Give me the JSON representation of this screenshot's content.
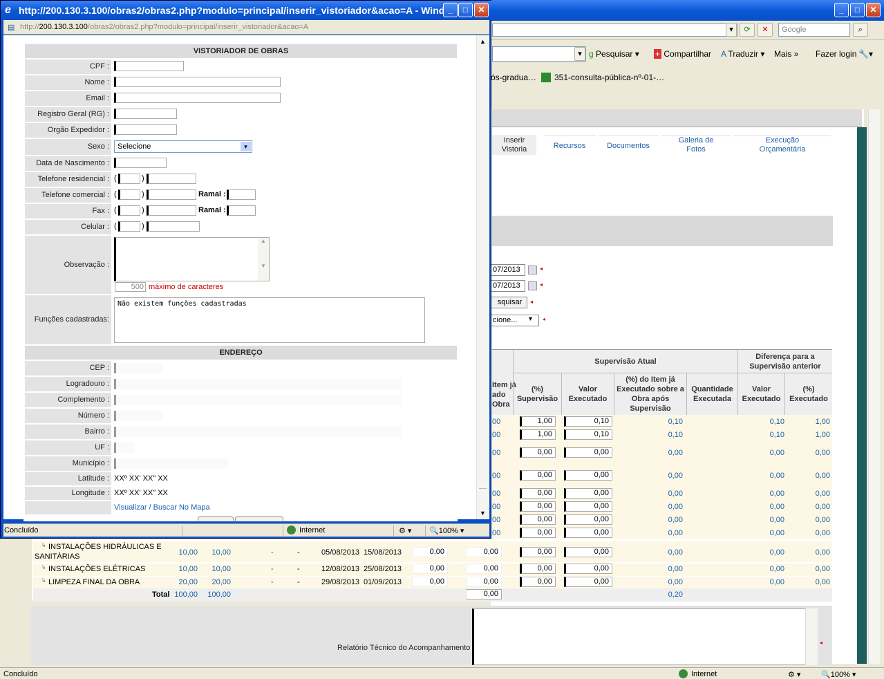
{
  "background_window": {
    "google_placeholder": "Google",
    "toolbar": {
      "pesquisar": "Pesquisar",
      "compartilhar": "Compartilhar",
      "traduzir": "Traduzir",
      "mais": "Mais",
      "login": "Fazer login"
    },
    "favorites": [
      "ós-gradua…",
      "351-consulta-pública-nº-01-…"
    ],
    "tabs": [
      "Inserir Vistoria",
      "Recursos",
      "Documentos",
      "Galeria de Fotos",
      "Execução Orçamentária"
    ],
    "filters": {
      "date1": "07/2013",
      "date2": "07/2013",
      "search_btn": "squisar",
      "select": "cione..."
    },
    "grid": {
      "group_supervisao_atual": "Supervisão Atual",
      "group_diferenca": "Diferença para a Supervisão anterior",
      "col_partial": "Item já\nado\nObra",
      "cols": [
        "(%) Supervisão",
        "Valor Executado",
        "(%) do Item já Executado sobre a Obra após Supervisão",
        "Quantidade Executada",
        "Valor Executado",
        "(%) Executado"
      ],
      "rows": [
        {
          "partial": "00",
          "pct": "1,00",
          "valor": "0,10",
          "item": "0,10",
          "dvalor": "0,10",
          "dpct": "1,00"
        },
        {
          "partial": "00",
          "pct": "1,00",
          "valor": "0,10",
          "item": "0,10",
          "dvalor": "0,10",
          "dpct": "1,00"
        },
        {
          "partial": "00",
          "pct": "0,00",
          "valor": "0,00",
          "item": "0,00",
          "dvalor": "0,00",
          "dpct": "0,00"
        },
        {
          "partial": "00",
          "pct": "0,00",
          "valor": "0,00",
          "item": "0,00",
          "dvalor": "0,00",
          "dpct": "0,00"
        },
        {
          "partial": "00",
          "pct": "0,00",
          "valor": "0,00",
          "item": "0,00",
          "dvalor": "0,00",
          "dpct": "0,00"
        },
        {
          "partial": "00",
          "pct": "0,00",
          "valor": "0,00",
          "item": "0,00",
          "dvalor": "0,00",
          "dpct": "0,00"
        },
        {
          "partial": "00",
          "pct": "0,00",
          "valor": "0,00",
          "item": "0,00",
          "dvalor": "0,00",
          "dpct": "0,00"
        },
        {
          "partial": "00",
          "pct": "0,00",
          "valor": "0,00",
          "item": "0,00",
          "dvalor": "0,00",
          "dpct": "0,00"
        }
      ],
      "full_rows": [
        {
          "name": "INSTALAÇÕES HIDRÁULICAS E SANITÁRIAS",
          "p1": "10,00",
          "p2": "10,00",
          "d1": "-",
          "d2": "-",
          "ini": "05/08/2013",
          "fim": "15/08/2013",
          "v1": "0,00",
          "v2": "0,00",
          "pct": "0,00",
          "valor": "0,00",
          "item": "0,00",
          "dvalor": "0,00",
          "dpct": "0,00"
        },
        {
          "name": "INSTALAÇÕES ELÉTRICAS",
          "p1": "10,00",
          "p2": "10,00",
          "d1": "-",
          "d2": "-",
          "ini": "12/08/2013",
          "fim": "25/08/2013",
          "v1": "0,00",
          "v2": "0,00",
          "pct": "0,00",
          "valor": "0,00",
          "item": "0,00",
          "dvalor": "0,00",
          "dpct": "0,00"
        },
        {
          "name": "LIMPEZA FINAL DA OBRA",
          "p1": "20,00",
          "p2": "20,00",
          "d1": "-",
          "d2": "-",
          "ini": "29/08/2013",
          "fim": "01/09/2013",
          "v1": "0,00",
          "v2": "0,00",
          "pct": "0,00",
          "valor": "0,00",
          "item": "0,00",
          "dvalor": "0,00",
          "dpct": "0,00"
        }
      ],
      "total": {
        "label": "Total",
        "p1": "100,00",
        "p2": "100,00",
        "v2": "0,00",
        "item": "0,20"
      }
    },
    "report_label": "Relatório Técnico do Acompanhamento",
    "status": {
      "left": "Concluído",
      "zone": "Internet",
      "zoom": "100%"
    }
  },
  "popup": {
    "title": "http://200.130.3.100/obras2/obras2.php?modulo=principal/inserir_vistoriador&acao=A - Wind…",
    "url_prefix": "http://",
    "url_host": "200.130.3.100",
    "url_path": "/obras2/obras2.php?modulo=principal/inserir_vistoriador&acao=A",
    "form": {
      "header": "VISTORIADOR DE OBRAS",
      "cpf": "CPF :",
      "nome": "Nome :",
      "email": "Email :",
      "rg": "Registro Geral (RG) :",
      "orgao": "Orgão Expedidor :",
      "sexo": "Sexo :",
      "sexo_value": "Selecione",
      "nascimento": "Data de Nascimento :",
      "tel_res": "Telefone residencial :",
      "tel_com": "Telefone comercial :",
      "fax": "Fax :",
      "celular": "Celular :",
      "ramal": "Ramal :",
      "obs": "Observação :",
      "obs_count": "500",
      "obs_hint": "máximo de caracteres",
      "funcoes": "Funções cadastradas:",
      "funcoes_value": "Não existem funções cadastradas",
      "endereco_header": "ENDEREÇO",
      "cep": "CEP :",
      "logradouro": "Logradouro :",
      "complemento": "Complemento :",
      "numero": "Número :",
      "bairro": "Bairro :",
      "uf": "UF :",
      "municipio": "Município :",
      "latitude": "Latitude :",
      "latitude_value": "XXº XX' XX\" XX",
      "longitude": "Longitude :",
      "longitude_value": "XXº XX' XX\" XX",
      "map_link": "Visualizar / Buscar No Mapa"
    },
    "status": {
      "left": "Concluído",
      "zone": "Internet",
      "zoom": "100%"
    }
  }
}
